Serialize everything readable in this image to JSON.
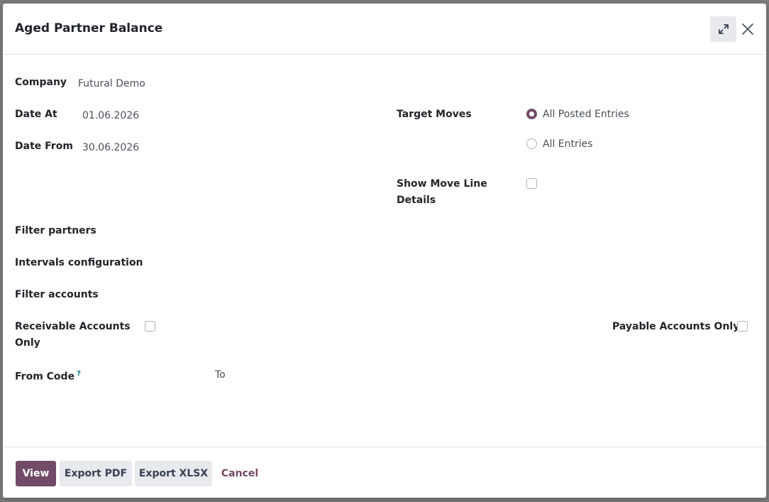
{
  "dialog": {
    "title": "Aged Partner Balance"
  },
  "form": {
    "company_label": "Company",
    "company_value": "Futural Demo",
    "date_at_label": "Date At",
    "date_at_value": "01.06.2026",
    "date_from_label": "Date From",
    "date_from_value": "30.06.2026",
    "target_moves_label": "Target Moves",
    "target_moves_options": [
      "All Posted Entries",
      "All Entries"
    ],
    "target_moves_selected": "All Posted Entries",
    "show_move_line_label_1": "Show Move Line",
    "show_move_line_label_2": "Details",
    "filter_partners_label": "Filter partners",
    "intervals_config_label": "Intervals configuration",
    "filter_accounts_label": "Filter accounts",
    "receivable_label_1": "Receivable Accounts",
    "receivable_label_2": "Only",
    "payable_label": "Payable Accounts Only",
    "from_code_label": "From Code",
    "from_code_help": "?",
    "to_label": "To"
  },
  "footer": {
    "view_label": "View",
    "export_pdf_label": "Export PDF",
    "export_xlsx_label": "Export XLSX",
    "cancel_label": "Cancel"
  },
  "colors": {
    "primary": "#714b67",
    "secondary_bg": "#e7e9ed",
    "help": "#017e84"
  },
  "icons": {
    "expand": "expand-icon",
    "close": "close-icon"
  }
}
